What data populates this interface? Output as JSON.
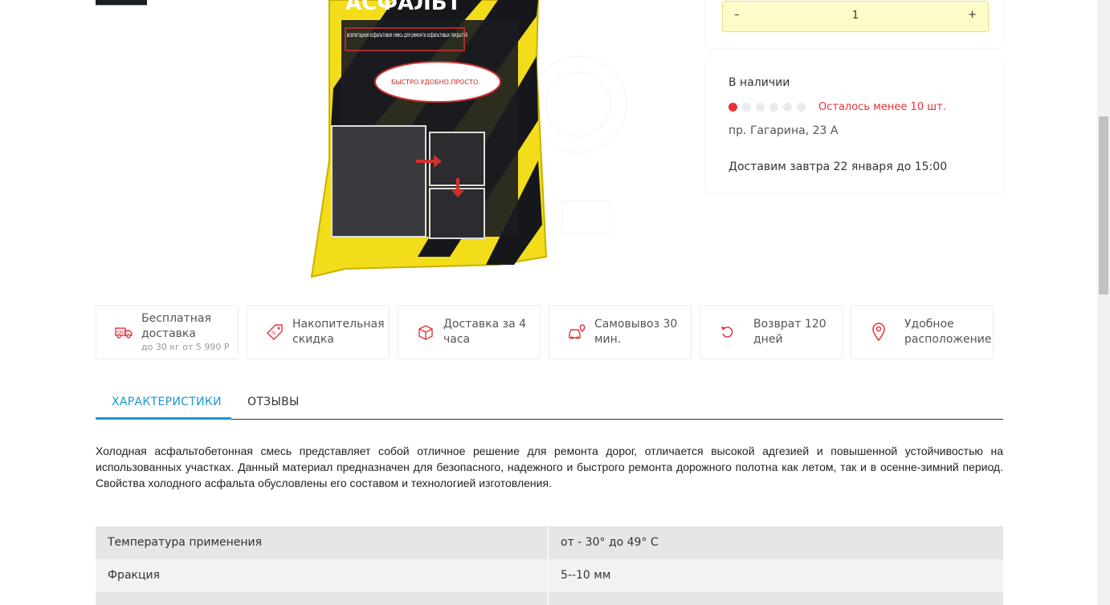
{
  "quantity": {
    "minus": "–",
    "value": "1",
    "plus": "+"
  },
  "availability": {
    "title": "В наличии",
    "stock_level": 1,
    "stock_max": 6,
    "stock_note": "Осталось менее 10 шт.",
    "address": "пр. Гагарина, 23 А",
    "delivery": "Доставим завтра 22 января до 15:00"
  },
  "product_image": {
    "package_title": "АСФАЛЬТ",
    "package_subtitle": "всепогодная асфальтовая смесь для ремонта асфальтовых покрытий",
    "package_slogan": "БЫСТРО.УДОБНО.ПРОСТО."
  },
  "features": [
    {
      "icon": "truck-icon",
      "label": "Бесплатная доставка",
      "sub": "до 30 кг от 5 990 Р"
    },
    {
      "icon": "discount-tag-icon",
      "label": "Накопительная скидка",
      "sub": ""
    },
    {
      "icon": "box-icon",
      "label": "Доставка за 4 часа",
      "sub": ""
    },
    {
      "icon": "car-pin-icon",
      "label": "Самовывоз 30 мин.",
      "sub": ""
    },
    {
      "icon": "return-icon",
      "label": "Возврат 120 дней",
      "sub": ""
    },
    {
      "icon": "location-pin-icon",
      "label": "Удобное расположение",
      "sub": ""
    }
  ],
  "tabs": {
    "active": "ХАРАКТЕРИСТИКИ",
    "second": "ОТЗЫВЫ"
  },
  "description": "Холодная асфальтобетонная смесь представляет собой отличное решение для ремонта дорог, отличается высокой адгезией и повышенной устойчивостью на использованных участках. Данный материал предназначен для безопасного, надежного и быстрого ремонта дорожного полотна как летом, так и в осенне-зимний период. Свойства холодного асфальта обусловлены его составом и технологией изготовления.",
  "specs": [
    {
      "name": "Температура применения",
      "value": "от - 30° до 49° С"
    },
    {
      "name": "Фракция",
      "value": "5--10 мм"
    },
    {
      "name": "",
      "value": ""
    }
  ],
  "colors": {
    "accent": "#1a96d4",
    "alert": "#e8313a",
    "qty_bg": "#fdfbc7"
  }
}
